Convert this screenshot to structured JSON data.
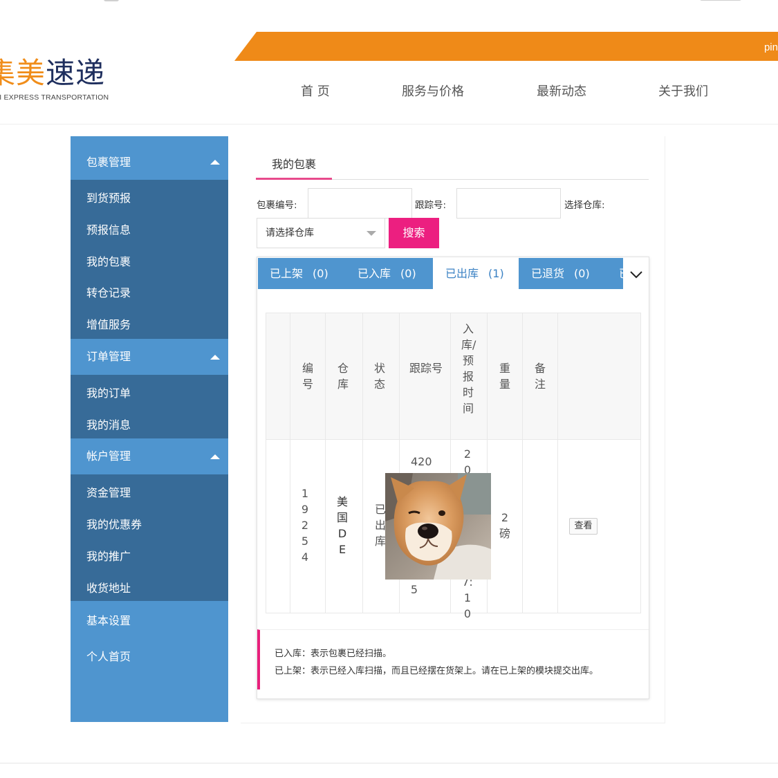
{
  "header": {
    "logo_cn_part1": "集",
    "logo_cn_part2": "美",
    "logo_cn_part3": "速递",
    "logo_en": "EI   EXPRESS TRANSPORTATION",
    "bar_text": "pin",
    "nav": [
      "首 页",
      "服务与价格",
      "最新动态",
      "关于我们"
    ],
    "colors": {
      "accent_orange": "#ef8a18",
      "logo_navy": "#1f2f5e"
    }
  },
  "sidebar": {
    "color": "#4f95cf",
    "groups": [
      {
        "label": "包裹管理",
        "items": [
          "到货预报",
          "预报信息",
          "我的包裹",
          "转仓记录",
          "增值服务"
        ]
      },
      {
        "label": "订单管理",
        "items": [
          "我的订单",
          "我的消息"
        ]
      },
      {
        "label": "帐户管理",
        "items": [
          "资金管理",
          "我的优惠券",
          "我的推广",
          "收货地址"
        ]
      }
    ],
    "extra": [
      "基本设置",
      "个人首页"
    ]
  },
  "main": {
    "tab": "我的包裹",
    "filters": {
      "parcel_no_label": "包裹编号:",
      "tracking_label": "跟踪号:",
      "warehouse_label": "选择仓库:",
      "warehouse_value": "请选择仓库",
      "search_button": "搜索"
    },
    "status_tabs": [
      {
        "label": "已上架",
        "count": "(0)"
      },
      {
        "label": "已入库",
        "count": "(0)"
      },
      {
        "label": "已出库",
        "count": "(1)",
        "active": true
      },
      {
        "label": "已退货",
        "count": "(0)"
      },
      {
        "label": "已",
        "count": ""
      }
    ],
    "table": {
      "headers": [
        "编号",
        "仓库",
        "状态",
        "跟踪号",
        "入库/预报时间",
        "重量",
        "备注"
      ],
      "rows": [
        {
          "id": "19254",
          "warehouse": "美国DE",
          "status": "已出库",
          "tracking_top": "4201",
          "tracking_bottom": "5",
          "time_top": "20",
          "time_bottom": "7:10",
          "weight": "2磅",
          "remark": "",
          "action": "查看"
        }
      ]
    },
    "notes": [
      "已入库：表示包裹已经扫描。",
      "已上架：表示已经入库扫描，而且已经摆在货架上。请在已上架的模块提交出库。"
    ],
    "colors": {
      "pink": "#ec1f80",
      "tab_blue": "#4f95cf"
    }
  }
}
